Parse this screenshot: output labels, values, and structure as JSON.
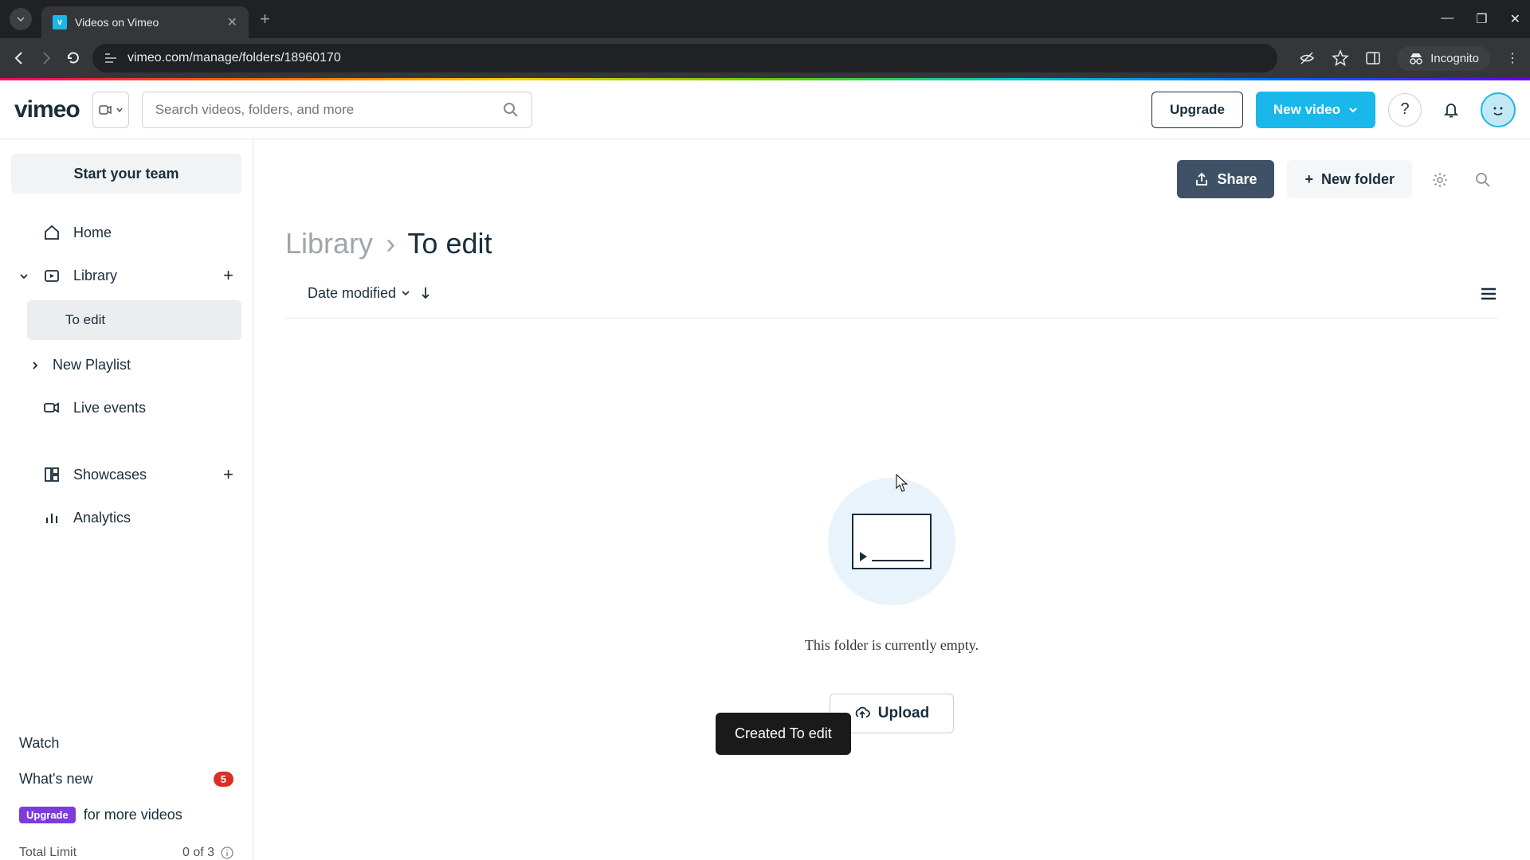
{
  "browser": {
    "tab_title": "Videos on Vimeo",
    "url": "vimeo.com/manage/folders/18960170",
    "incognito_label": "Incognito"
  },
  "header": {
    "logo_text": "vimeo",
    "search_placeholder": "Search videos, folders, and more",
    "upgrade_label": "Upgrade",
    "new_video_label": "New video"
  },
  "sidebar": {
    "start_team_label": "Start your team",
    "items": {
      "home": "Home",
      "library": "Library",
      "to_edit": "To edit",
      "new_playlist": "New Playlist",
      "live_events": "Live events",
      "showcases": "Showcases",
      "analytics": "Analytics"
    },
    "watch": "Watch",
    "whats_new": "What's new",
    "whats_new_count": "5",
    "upgrade_label": "Upgrade",
    "upgrade_text": "for more videos",
    "limit_label": "Total Limit",
    "limit_value": "0 of 3"
  },
  "main": {
    "share_label": "Share",
    "new_folder_label": "New folder",
    "breadcrumb_parent": "Library",
    "breadcrumb_current": "To edit",
    "sort_label": "Date modified",
    "empty_text": "This folder is currently empty.",
    "upload_label": "Upload",
    "toast_text": "Created To edit"
  }
}
